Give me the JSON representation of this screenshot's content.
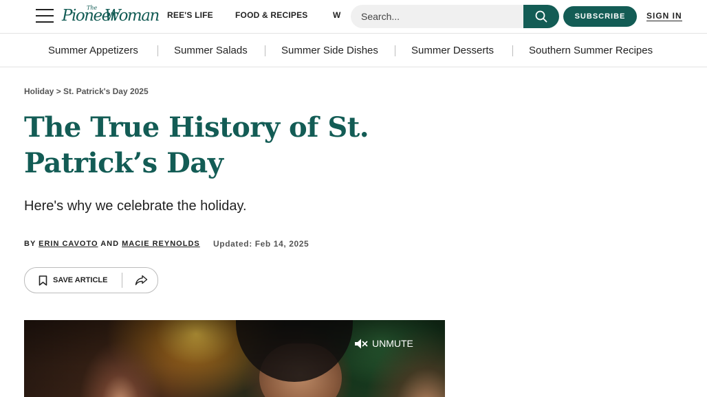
{
  "header": {
    "menu_icon": "hamburger-menu-icon",
    "logo": {
      "line_small": "The",
      "line_1": "Pioneer",
      "line_2": "Woman"
    },
    "nav_items": [
      {
        "label": "REE'S LIFE"
      },
      {
        "label": "FOOD & RECIPES"
      },
      {
        "label": "W"
      }
    ],
    "search": {
      "placeholder": "Search...",
      "icon": "search-icon"
    },
    "subscribe_label": "SUBSCRIBE",
    "signin_label": "SIGN IN"
  },
  "subnav": {
    "items": [
      {
        "label": "Summer Appetizers"
      },
      {
        "label": "Summer Salads"
      },
      {
        "label": "Summer Side Dishes"
      },
      {
        "label": "Summer Desserts"
      },
      {
        "label": "Southern Summer Recipes"
      }
    ]
  },
  "breadcrumb": {
    "parent": "Holiday",
    "separator": ">",
    "current": "St. Patrick's Day 2025"
  },
  "article": {
    "title": "The True History of St. Patrick’s Day",
    "dek": "Here's why we celebrate the holiday.",
    "byline": {
      "by": "BY",
      "author_1": "ERIN CAVOTO",
      "conjunction": "AND",
      "author_2": "MACIE REYNOLDS"
    },
    "updated": "Updated: Feb 14, 2025",
    "actions": {
      "save_label": "SAVE ARTICLE",
      "save_icon": "bookmark-icon",
      "share_icon": "share-icon"
    }
  },
  "video": {
    "unmute_label": "UNMUTE",
    "unmute_icon": "muted-speaker-icon"
  },
  "colors": {
    "brand": "#135c55",
    "text": "#222222",
    "muted": "#555555",
    "divider": "#e3e3e3"
  }
}
